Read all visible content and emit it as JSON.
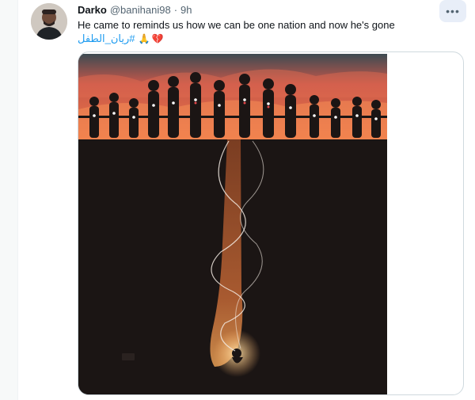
{
  "tweet": {
    "display_name": "Darko",
    "handle": "@banihani98",
    "separator": "·",
    "time": "9h",
    "more_icon": "more-horizontal-icon",
    "text": "He came to reminds us how we can be one nation and now he's gone",
    "hashtag": "#ريان_الطفل",
    "emoji_pray": "🙏",
    "emoji_heart": "💔",
    "media_icon": "illustration-image"
  },
  "colors": {
    "link": "#1d9bf0",
    "text": "#0f1419",
    "muted": "#536471",
    "sky": "#e8553a",
    "ground": "#1b1514"
  }
}
